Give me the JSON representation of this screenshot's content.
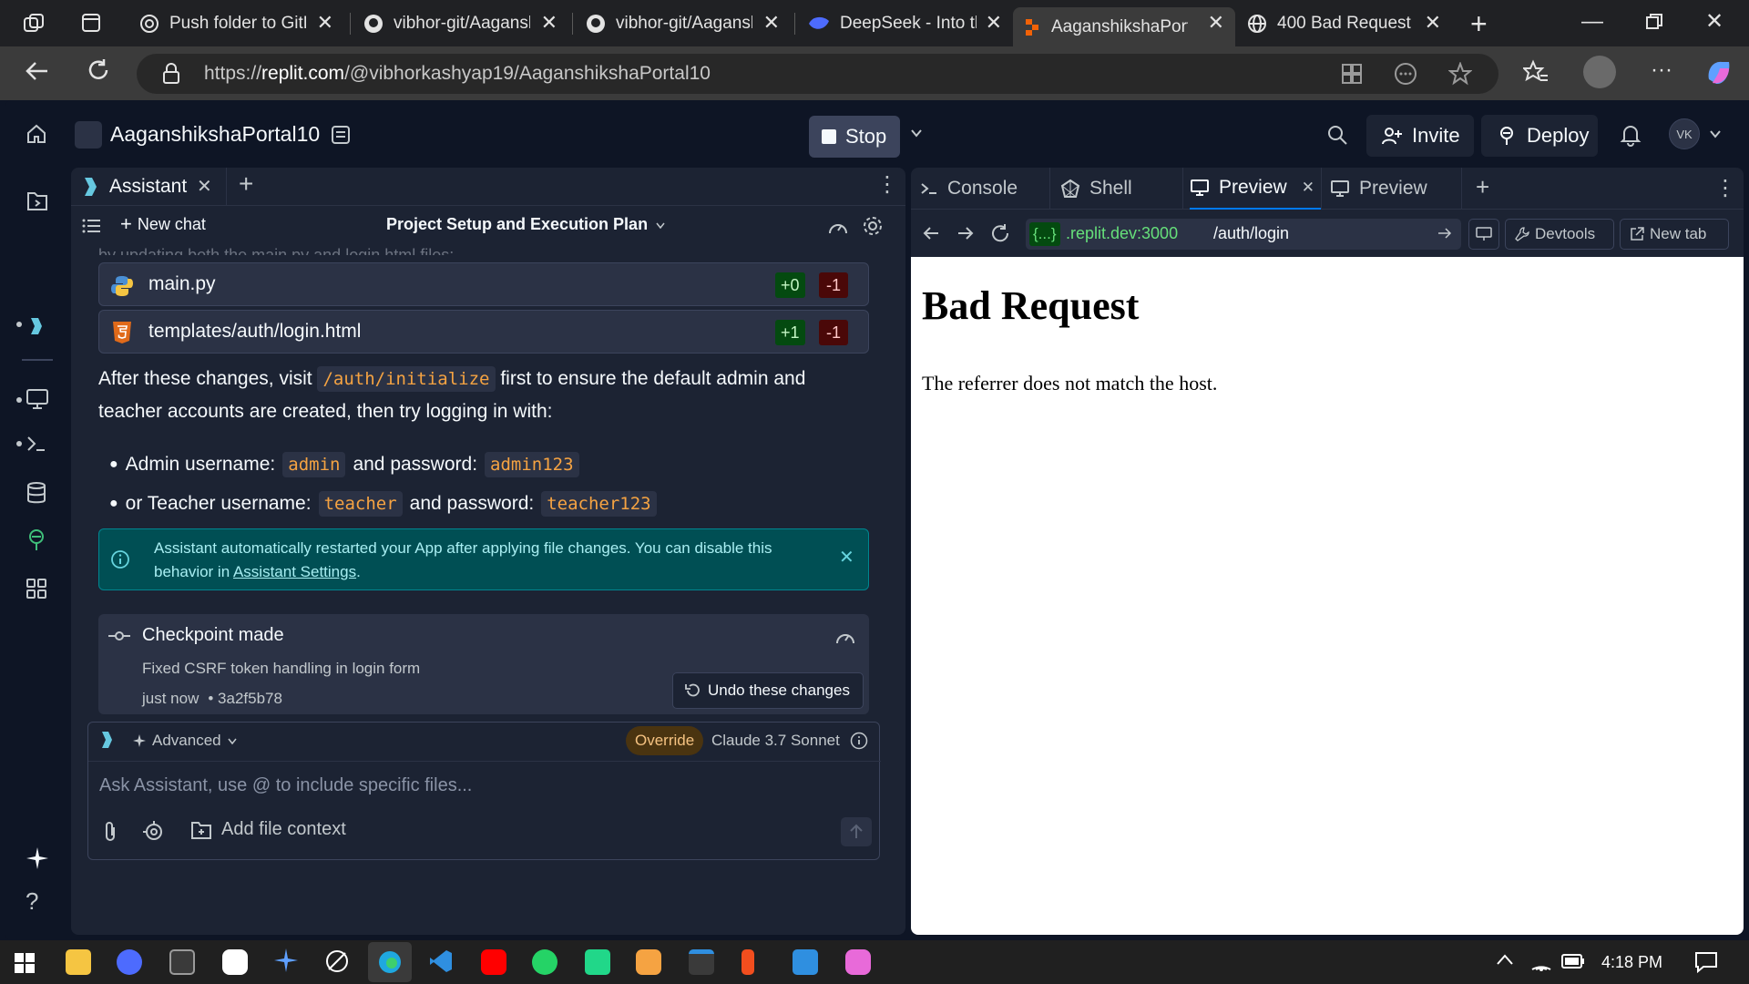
{
  "browser": {
    "tabs": [
      {
        "title": "Push folder to GitH",
        "icon": "openai-icon"
      },
      {
        "title": "vibhor-git/Aagansh",
        "icon": "github-icon"
      },
      {
        "title": "vibhor-git/Aagansh",
        "icon": "github-icon"
      },
      {
        "title": "DeepSeek - Into th",
        "icon": "deepseek-icon"
      },
      {
        "title": "AaganshikshaPorta",
        "icon": "replit-icon",
        "active": true
      },
      {
        "title": "400 Bad Request",
        "icon": "globe-icon"
      }
    ],
    "url_prefix": "https://",
    "url_host": "replit.com",
    "url_path": "/@vibhorkashyap19/AaganshikshaPortal10"
  },
  "app": {
    "project_name": "AaganshikshaPortal10",
    "stop_label": "Stop",
    "invite_label": "Invite",
    "deploy_label": "Deploy",
    "avatar_initials": "VK"
  },
  "assistant": {
    "tab_label": "Assistant",
    "new_chat_label": "New chat",
    "chat_title": "Project Setup and Execution Plan",
    "faded_text": "by updating both the main.py and login.html files:",
    "files": [
      {
        "name": "main.py",
        "plus": "+0",
        "minus": "-1"
      },
      {
        "name": "templates/auth/login.html",
        "plus": "+1",
        "minus": "-1"
      }
    ],
    "para_before": "After these changes, visit",
    "para_code": "/auth/initialize",
    "para_after": "first to ensure the default admin and",
    "para_line2": "teacher accounts are created, then try logging in with:",
    "bullets": [
      {
        "a": "Admin username:",
        "c1": "admin",
        "b": "and password:",
        "c2": "admin123"
      },
      {
        "a": "or Teacher username:",
        "c1": "teacher",
        "b": "and password:",
        "c2": "teacher123"
      }
    ],
    "notice_line1": "Assistant automatically restarted your App after applying file changes. You can disable this",
    "notice_line2_pre": "behavior in",
    "notice_link": "Assistant Settings",
    "notice_line2_post": ".",
    "checkpoint_title": "Checkpoint made",
    "checkpoint_desc": "Fixed CSRF token handling in login form",
    "checkpoint_time": "just now",
    "checkpoint_hash": "• 3a2f5b78",
    "undo_label": "Undo these changes",
    "composer_mode": "Advanced",
    "override_label": "Override",
    "model_label": "Claude 3.7 Sonnet",
    "input_placeholder": "Ask Assistant, use @ to include specific files...",
    "add_context_label": "Add file context"
  },
  "right_panel": {
    "tabs": [
      "Console",
      "Shell",
      "Preview",
      "Preview"
    ],
    "url_badge": "{...}",
    "url_host": ".replit.dev:3000",
    "url_path": "/auth/login",
    "devtools_label": "Devtools",
    "newtab_label": "New tab"
  },
  "preview_page": {
    "heading": "Bad Request",
    "message": "The referrer does not match the host."
  },
  "taskbar": {
    "time": "4:18 PM"
  },
  "colors": {
    "accent_orange": "#f5a342",
    "notice_bg": "#004f54",
    "panel_bg": "#1c2333",
    "page_bg": "#0e1525"
  }
}
